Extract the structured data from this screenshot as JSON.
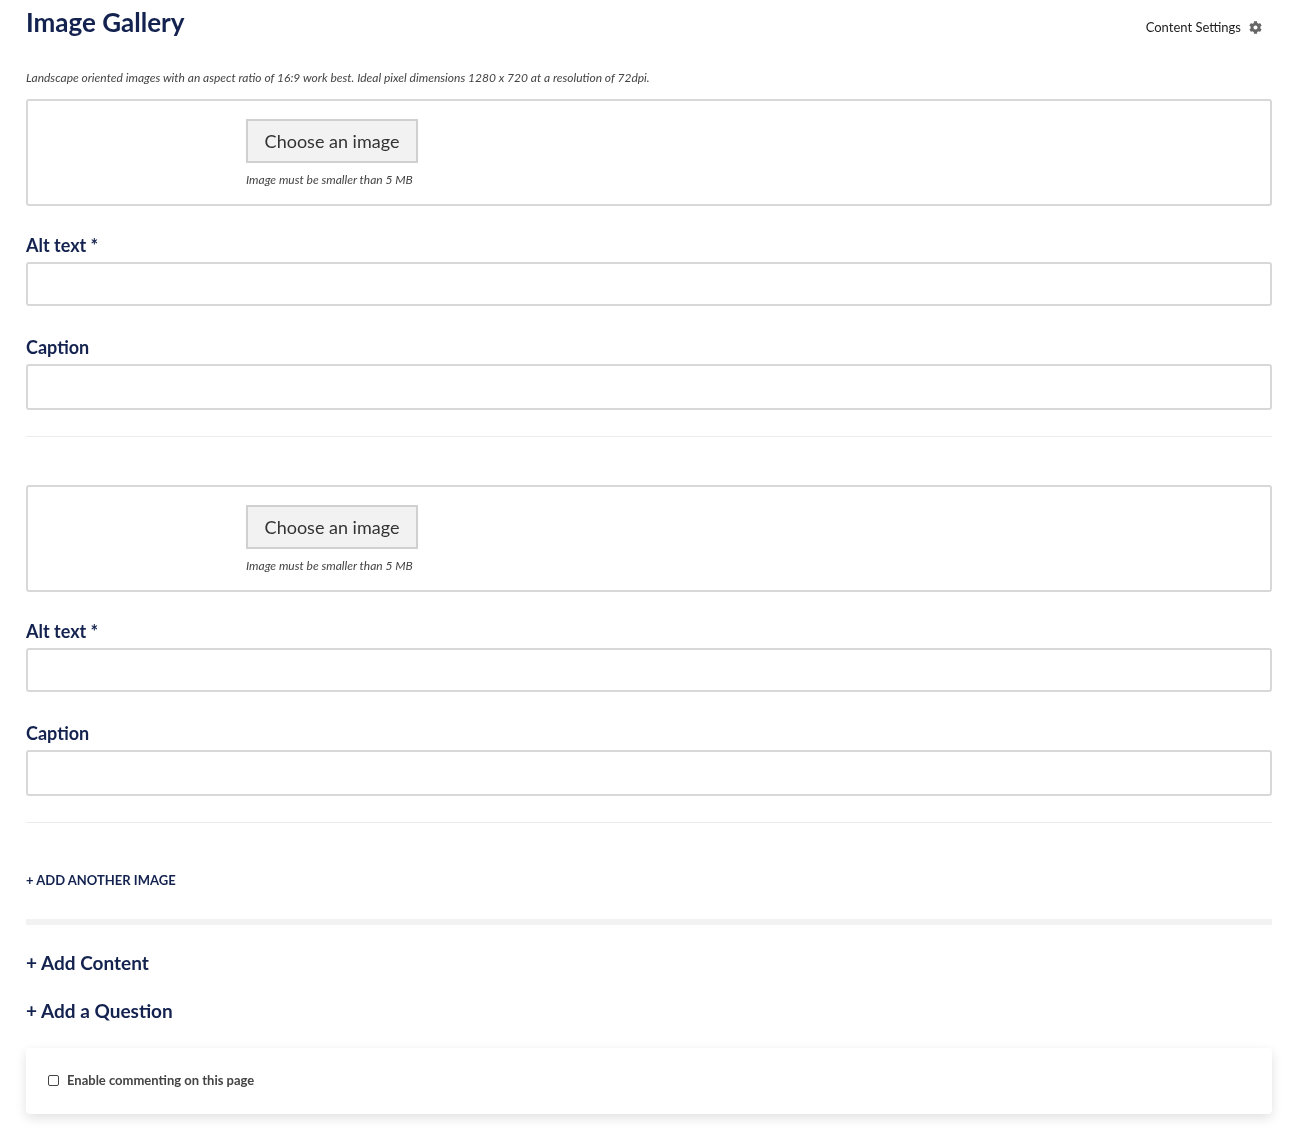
{
  "title": "Image Gallery",
  "settings_link": "Content Settings",
  "hint": "Landscape oriented images with an aspect ratio of 16:9 work best. Ideal pixel dimensions 1280 x 720 at a resolution of 72dpi.",
  "images": [
    {
      "choose_button": "Choose an image",
      "size_hint": "Image must be smaller than 5 MB",
      "alt_label": "Alt text *",
      "caption_label": "Caption"
    },
    {
      "choose_button": "Choose an image",
      "size_hint": "Image must be smaller than 5 MB",
      "alt_label": "Alt text *",
      "caption_label": "Caption"
    }
  ],
  "add_image": "+ ADD ANOTHER IMAGE",
  "add_content": "+ Add Content",
  "add_question": "+ Add a Question",
  "commenting": {
    "label": "Enable commenting on this page",
    "checked": false
  }
}
